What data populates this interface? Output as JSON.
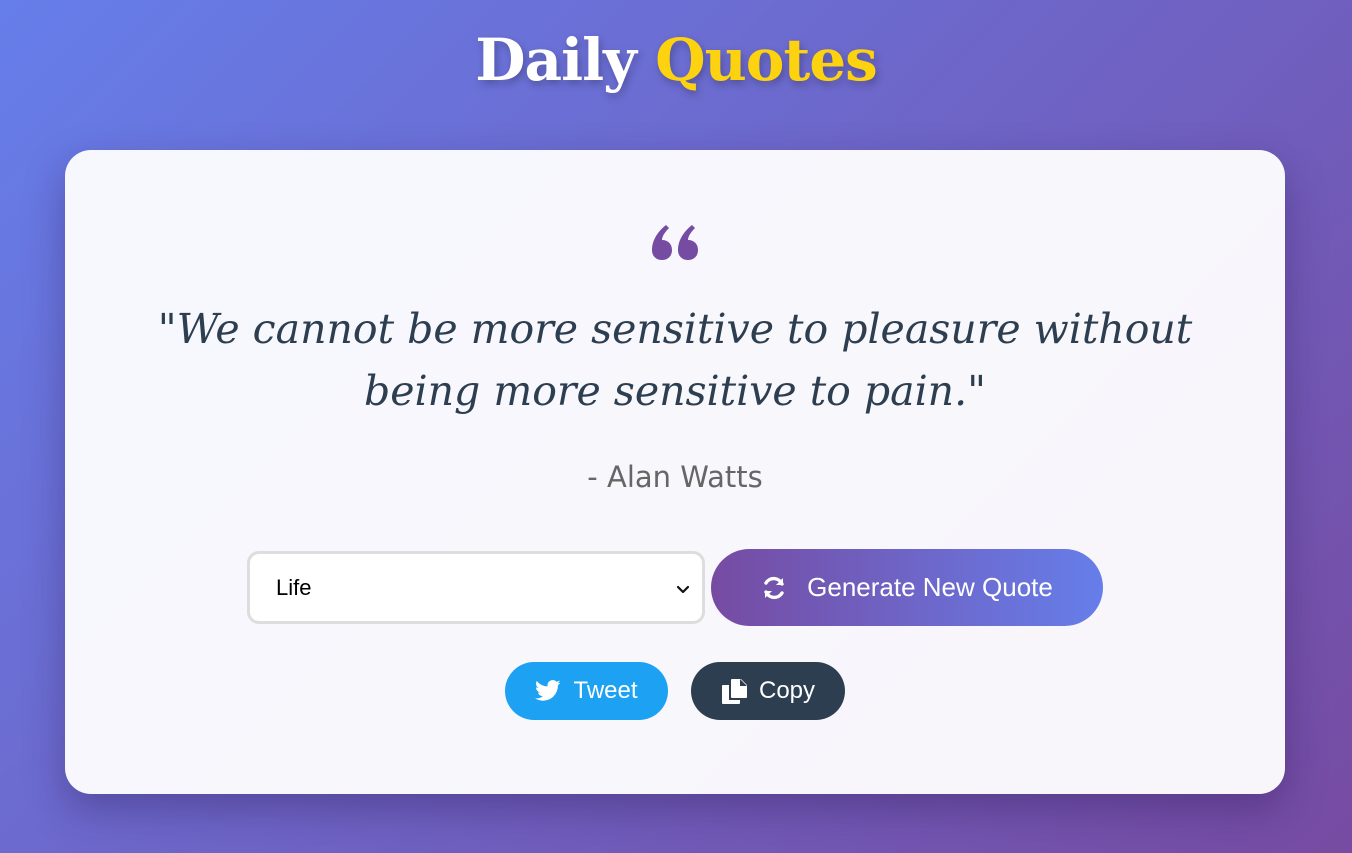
{
  "header": {
    "title_part1": "Daily",
    "title_part2": "Quotes",
    "accent_color": "#fdd20e"
  },
  "quote": {
    "icon": "quote-left-icon",
    "text": "\"We cannot be more sensitive to pleasure without being more sensitive to pain.\"",
    "author": "- Alan Watts",
    "icon_color": "#764ba2"
  },
  "controls": {
    "category_selected": "Life",
    "generate_label": "Generate New Quote",
    "generate_icon": "refresh-icon"
  },
  "share": {
    "tweet_label": "Tweet",
    "tweet_icon": "twitter-icon",
    "tweet_color": "#1da1f2",
    "copy_label": "Copy",
    "copy_icon": "copy-icon",
    "copy_color": "#2c3e50"
  }
}
